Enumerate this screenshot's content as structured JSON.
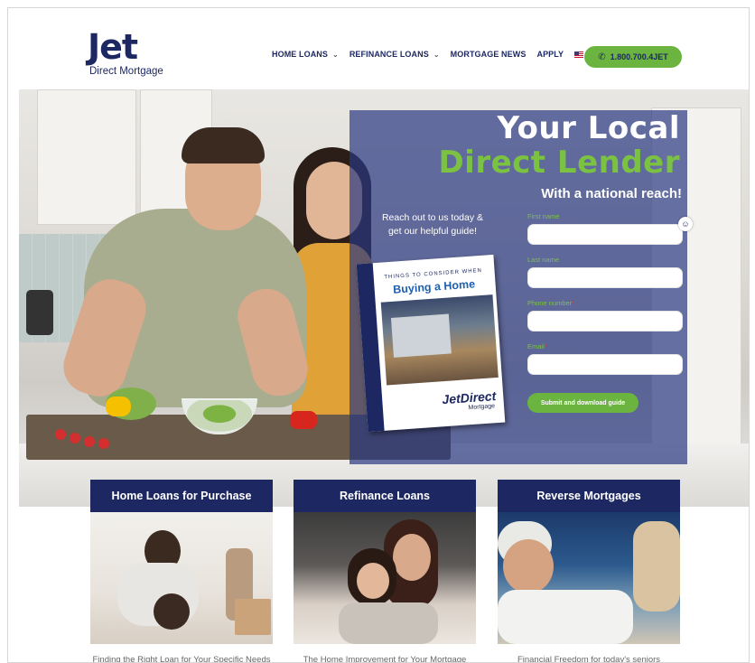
{
  "logo": {
    "title": "Jet",
    "subtitle": "Direct Mortgage"
  },
  "nav": {
    "items": [
      {
        "label": "HOME LOANS",
        "dropdown": true
      },
      {
        "label": "REFINANCE LOANS",
        "dropdown": true
      },
      {
        "label": "MORTGAGE NEWS",
        "dropdown": false
      },
      {
        "label": "APPLY",
        "dropdown": false
      }
    ],
    "phone": "1.800.700.4JET"
  },
  "hero": {
    "title_line1": "Your Local",
    "title_line2": "Direct Lender",
    "subtitle": "With a national reach!",
    "reach_text": "Reach out to us today & get our helpful guide!",
    "guide": {
      "kicker": "THINGS TO CONSIDER WHEN",
      "title": "Buying a Home",
      "brand": "JetDirect",
      "brand_sub": "Mortgage"
    },
    "form": {
      "first_name_label": "First name",
      "last_name_label": "Last name",
      "phone_label": "Phone number",
      "email_label": "Email",
      "first_name_value": "",
      "last_name_value": "",
      "phone_value": "",
      "email_value": "",
      "submit_label": "Submit and download guide"
    }
  },
  "cards": [
    {
      "title": "Home Loans for Purchase",
      "description": "Finding the Right Loan for Your Specific Needs"
    },
    {
      "title": "Refinance Loans",
      "description": "The Home Improvement for Your Mortgage"
    },
    {
      "title": "Reverse Mortgages",
      "description": "Financial Freedom for today's seniors"
    }
  ],
  "colors": {
    "navy": "#1d2862",
    "green": "#6bb43f",
    "accent_green": "#7cc242"
  }
}
